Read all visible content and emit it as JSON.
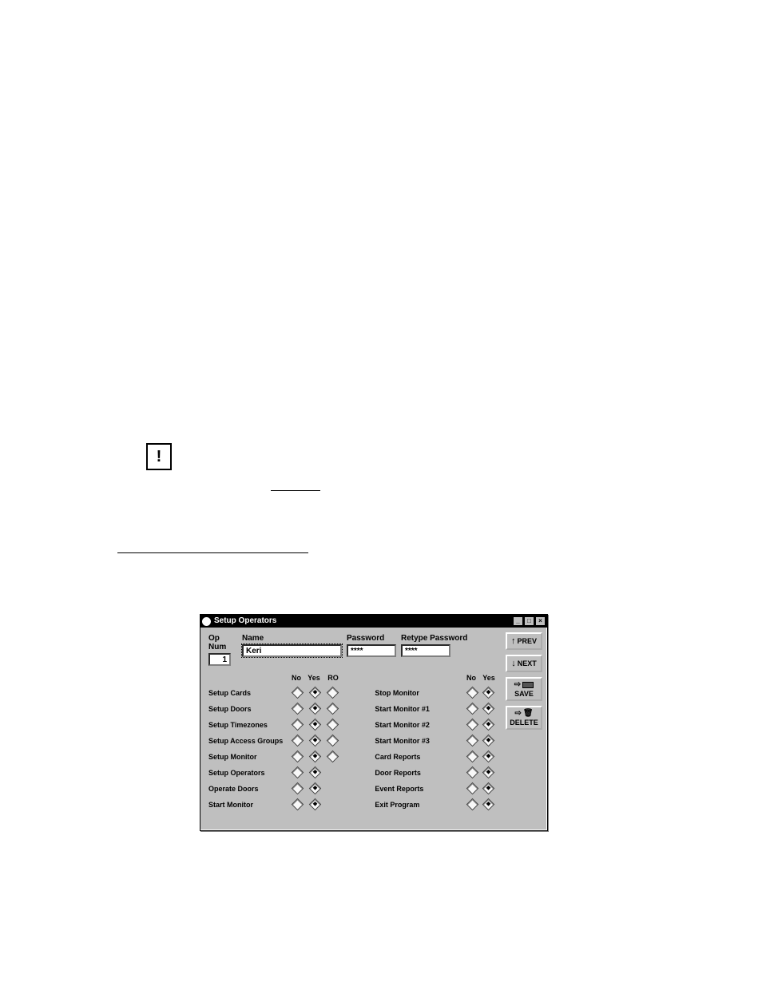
{
  "window": {
    "title": "Setup Operators",
    "labels": {
      "op_num": "Op Num",
      "name": "Name",
      "password": "Password",
      "retype_password": "Retype Password"
    },
    "inputs": {
      "op_num": "1",
      "name": "Keri",
      "password": "****",
      "retype_password": "****"
    },
    "headers": {
      "no": "No",
      "yes": "Yes",
      "ro": "RO"
    },
    "buttons": {
      "prev": "PREV",
      "next": "NEXT",
      "save": "SAVE",
      "delete": "DELETE"
    },
    "left_rows": [
      {
        "label": "Setup Cards",
        "has_ro": true,
        "sel": "yes"
      },
      {
        "label": "Setup Doors",
        "has_ro": true,
        "sel": "yes"
      },
      {
        "label": "Setup Timezones",
        "has_ro": true,
        "sel": "yes"
      },
      {
        "label": "Setup Access Groups",
        "has_ro": true,
        "sel": "yes"
      },
      {
        "label": "Setup Monitor",
        "has_ro": true,
        "sel": "yes"
      },
      {
        "label": "Setup Operators",
        "has_ro": false,
        "sel": "yes"
      },
      {
        "label": "Operate Doors",
        "has_ro": false,
        "sel": "yes"
      },
      {
        "label": "Start Monitor",
        "has_ro": false,
        "sel": "yes"
      }
    ],
    "right_rows": [
      {
        "label": "Stop Monitor",
        "sel": "yes"
      },
      {
        "label": "Start Monitor #1",
        "sel": "yes"
      },
      {
        "label": "Start Monitor #2",
        "sel": "yes"
      },
      {
        "label": "Start Monitor #3",
        "sel": "yes"
      },
      {
        "label": "Card Reports",
        "sel": "yes"
      },
      {
        "label": "Door Reports",
        "sel": "yes"
      },
      {
        "label": "Event Reports",
        "sel": "yes"
      },
      {
        "label": "Exit Program",
        "sel": "yes"
      }
    ]
  }
}
